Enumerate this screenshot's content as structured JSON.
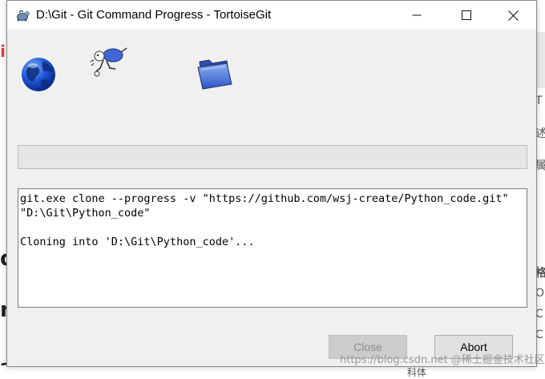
{
  "window": {
    "title": "D:\\Git - Git Command Progress - TortoiseGit"
  },
  "icons": {
    "app": "tortoisegit-icon",
    "source": "globe-icon",
    "animation": "running-turtle-icon",
    "destination": "folder-icon"
  },
  "progress": {
    "value": 0
  },
  "log": {
    "lines": [
      "git.exe clone --progress -v \"https://github.com/wsj-create/Python_code.git\"",
      "\"D:\\Git\\Python_code\"",
      "",
      "Cloning into 'D:\\Git\\Python_code'..."
    ]
  },
  "buttons": {
    "close_label": "Close",
    "abort_label": "Abort"
  },
  "background": {
    "watermark": "https://blog.csdn.net  @稀土掘金技术社区",
    "right_chars": [
      "T",
      "述",
      "属",
      "格",
      "O",
      "C",
      "C",
      "科体"
    ],
    "left_chars": [
      "i",
      "d",
      "n",
      "s.)"
    ]
  },
  "colors": {
    "dialog_bg": "#f0f0f0",
    "progress_green": "#06b025",
    "disabled_button": "#cccccc"
  }
}
